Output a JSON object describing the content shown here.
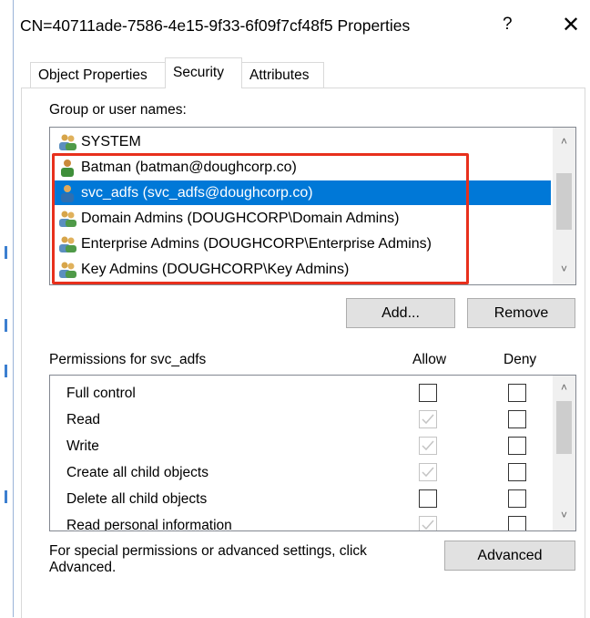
{
  "window": {
    "title": "CN=40711ade-7586-4e15-9f33-6f09f7cf48f5 Properties",
    "help_glyph": "?",
    "close_glyph": "✕"
  },
  "tabs": [
    {
      "label": "Object Properties",
      "active": false
    },
    {
      "label": "Security",
      "active": true
    },
    {
      "label": "Attributes",
      "active": false
    }
  ],
  "group_section": {
    "label": "Group or user names:",
    "items": [
      {
        "label": "SYSTEM",
        "icon": "group-icon",
        "selected": false
      },
      {
        "label": "Batman (batman@doughcorp.co)",
        "icon": "user-icon",
        "selected": false
      },
      {
        "label": "svc_adfs (svc_adfs@doughcorp.co)",
        "icon": "user-icon",
        "selected": true
      },
      {
        "label": "Domain Admins (DOUGHCORP\\Domain Admins)",
        "icon": "group-icon",
        "selected": false
      },
      {
        "label": "Enterprise Admins (DOUGHCORP\\Enterprise Admins)",
        "icon": "group-icon",
        "selected": false
      },
      {
        "label": "Key Admins (DOUGHCORP\\Key Admins)",
        "icon": "group-icon",
        "selected": false
      }
    ],
    "add_label": "Add...",
    "remove_label": "Remove"
  },
  "permissions": {
    "header": "Permissions for svc_adfs",
    "allow_header": "Allow",
    "deny_header": "Deny",
    "rows": [
      {
        "label": "Full control",
        "allow": "unchecked",
        "deny": "unchecked"
      },
      {
        "label": "Read",
        "allow": "checked-disabled",
        "deny": "unchecked"
      },
      {
        "label": "Write",
        "allow": "checked-disabled",
        "deny": "unchecked"
      },
      {
        "label": "Create all child objects",
        "allow": "checked-disabled",
        "deny": "unchecked"
      },
      {
        "label": "Delete all child objects",
        "allow": "unchecked",
        "deny": "unchecked"
      },
      {
        "label": "Read personal information",
        "allow": "checked-disabled",
        "deny": "unchecked"
      }
    ]
  },
  "advanced": {
    "note": "For special permissions or advanced settings, click Advanced.",
    "button_label": "Advanced"
  },
  "colors": {
    "selection": "#0078d7",
    "annotation_box": "#e8301c"
  }
}
